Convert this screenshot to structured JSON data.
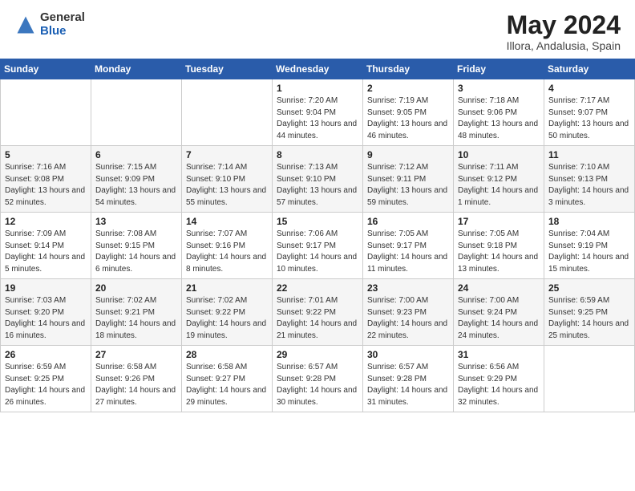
{
  "header": {
    "logo_general": "General",
    "logo_blue": "Blue",
    "month_year": "May 2024",
    "location": "Illora, Andalusia, Spain"
  },
  "days_of_week": [
    "Sunday",
    "Monday",
    "Tuesday",
    "Wednesday",
    "Thursday",
    "Friday",
    "Saturday"
  ],
  "weeks": [
    [
      {
        "day": "",
        "sunrise": "",
        "sunset": "",
        "daylight": ""
      },
      {
        "day": "",
        "sunrise": "",
        "sunset": "",
        "daylight": ""
      },
      {
        "day": "",
        "sunrise": "",
        "sunset": "",
        "daylight": ""
      },
      {
        "day": "1",
        "sunrise": "Sunrise: 7:20 AM",
        "sunset": "Sunset: 9:04 PM",
        "daylight": "Daylight: 13 hours and 44 minutes."
      },
      {
        "day": "2",
        "sunrise": "Sunrise: 7:19 AM",
        "sunset": "Sunset: 9:05 PM",
        "daylight": "Daylight: 13 hours and 46 minutes."
      },
      {
        "day": "3",
        "sunrise": "Sunrise: 7:18 AM",
        "sunset": "Sunset: 9:06 PM",
        "daylight": "Daylight: 13 hours and 48 minutes."
      },
      {
        "day": "4",
        "sunrise": "Sunrise: 7:17 AM",
        "sunset": "Sunset: 9:07 PM",
        "daylight": "Daylight: 13 hours and 50 minutes."
      }
    ],
    [
      {
        "day": "5",
        "sunrise": "Sunrise: 7:16 AM",
        "sunset": "Sunset: 9:08 PM",
        "daylight": "Daylight: 13 hours and 52 minutes."
      },
      {
        "day": "6",
        "sunrise": "Sunrise: 7:15 AM",
        "sunset": "Sunset: 9:09 PM",
        "daylight": "Daylight: 13 hours and 54 minutes."
      },
      {
        "day": "7",
        "sunrise": "Sunrise: 7:14 AM",
        "sunset": "Sunset: 9:10 PM",
        "daylight": "Daylight: 13 hours and 55 minutes."
      },
      {
        "day": "8",
        "sunrise": "Sunrise: 7:13 AM",
        "sunset": "Sunset: 9:10 PM",
        "daylight": "Daylight: 13 hours and 57 minutes."
      },
      {
        "day": "9",
        "sunrise": "Sunrise: 7:12 AM",
        "sunset": "Sunset: 9:11 PM",
        "daylight": "Daylight: 13 hours and 59 minutes."
      },
      {
        "day": "10",
        "sunrise": "Sunrise: 7:11 AM",
        "sunset": "Sunset: 9:12 PM",
        "daylight": "Daylight: 14 hours and 1 minute."
      },
      {
        "day": "11",
        "sunrise": "Sunrise: 7:10 AM",
        "sunset": "Sunset: 9:13 PM",
        "daylight": "Daylight: 14 hours and 3 minutes."
      }
    ],
    [
      {
        "day": "12",
        "sunrise": "Sunrise: 7:09 AM",
        "sunset": "Sunset: 9:14 PM",
        "daylight": "Daylight: 14 hours and 5 minutes."
      },
      {
        "day": "13",
        "sunrise": "Sunrise: 7:08 AM",
        "sunset": "Sunset: 9:15 PM",
        "daylight": "Daylight: 14 hours and 6 minutes."
      },
      {
        "day": "14",
        "sunrise": "Sunrise: 7:07 AM",
        "sunset": "Sunset: 9:16 PM",
        "daylight": "Daylight: 14 hours and 8 minutes."
      },
      {
        "day": "15",
        "sunrise": "Sunrise: 7:06 AM",
        "sunset": "Sunset: 9:17 PM",
        "daylight": "Daylight: 14 hours and 10 minutes."
      },
      {
        "day": "16",
        "sunrise": "Sunrise: 7:05 AM",
        "sunset": "Sunset: 9:17 PM",
        "daylight": "Daylight: 14 hours and 11 minutes."
      },
      {
        "day": "17",
        "sunrise": "Sunrise: 7:05 AM",
        "sunset": "Sunset: 9:18 PM",
        "daylight": "Daylight: 14 hours and 13 minutes."
      },
      {
        "day": "18",
        "sunrise": "Sunrise: 7:04 AM",
        "sunset": "Sunset: 9:19 PM",
        "daylight": "Daylight: 14 hours and 15 minutes."
      }
    ],
    [
      {
        "day": "19",
        "sunrise": "Sunrise: 7:03 AM",
        "sunset": "Sunset: 9:20 PM",
        "daylight": "Daylight: 14 hours and 16 minutes."
      },
      {
        "day": "20",
        "sunrise": "Sunrise: 7:02 AM",
        "sunset": "Sunset: 9:21 PM",
        "daylight": "Daylight: 14 hours and 18 minutes."
      },
      {
        "day": "21",
        "sunrise": "Sunrise: 7:02 AM",
        "sunset": "Sunset: 9:22 PM",
        "daylight": "Daylight: 14 hours and 19 minutes."
      },
      {
        "day": "22",
        "sunrise": "Sunrise: 7:01 AM",
        "sunset": "Sunset: 9:22 PM",
        "daylight": "Daylight: 14 hours and 21 minutes."
      },
      {
        "day": "23",
        "sunrise": "Sunrise: 7:00 AM",
        "sunset": "Sunset: 9:23 PM",
        "daylight": "Daylight: 14 hours and 22 minutes."
      },
      {
        "day": "24",
        "sunrise": "Sunrise: 7:00 AM",
        "sunset": "Sunset: 9:24 PM",
        "daylight": "Daylight: 14 hours and 24 minutes."
      },
      {
        "day": "25",
        "sunrise": "Sunrise: 6:59 AM",
        "sunset": "Sunset: 9:25 PM",
        "daylight": "Daylight: 14 hours and 25 minutes."
      }
    ],
    [
      {
        "day": "26",
        "sunrise": "Sunrise: 6:59 AM",
        "sunset": "Sunset: 9:25 PM",
        "daylight": "Daylight: 14 hours and 26 minutes."
      },
      {
        "day": "27",
        "sunrise": "Sunrise: 6:58 AM",
        "sunset": "Sunset: 9:26 PM",
        "daylight": "Daylight: 14 hours and 27 minutes."
      },
      {
        "day": "28",
        "sunrise": "Sunrise: 6:58 AM",
        "sunset": "Sunset: 9:27 PM",
        "daylight": "Daylight: 14 hours and 29 minutes."
      },
      {
        "day": "29",
        "sunrise": "Sunrise: 6:57 AM",
        "sunset": "Sunset: 9:28 PM",
        "daylight": "Daylight: 14 hours and 30 minutes."
      },
      {
        "day": "30",
        "sunrise": "Sunrise: 6:57 AM",
        "sunset": "Sunset: 9:28 PM",
        "daylight": "Daylight: 14 hours and 31 minutes."
      },
      {
        "day": "31",
        "sunrise": "Sunrise: 6:56 AM",
        "sunset": "Sunset: 9:29 PM",
        "daylight": "Daylight: 14 hours and 32 minutes."
      },
      {
        "day": "",
        "sunrise": "",
        "sunset": "",
        "daylight": ""
      }
    ]
  ]
}
